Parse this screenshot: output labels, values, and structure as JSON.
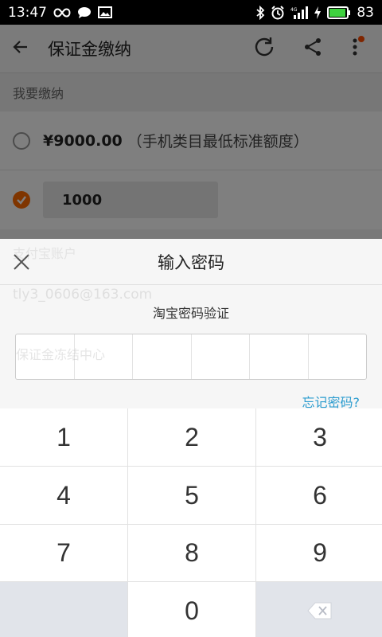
{
  "status": {
    "time": "13:47",
    "battery": "83"
  },
  "appbar": {
    "title": "保证金缴纳"
  },
  "section": {
    "label": "我要缴纳"
  },
  "options": [
    {
      "amount": "¥9000.00",
      "note": "（手机类目最低标准额度）",
      "checked": false
    },
    {
      "input_value": "1000",
      "checked": true
    }
  ],
  "background": {
    "account_label": "支付宝账户",
    "account": "tly3_0606@163.com",
    "pin_placeholder": "保证金冻结中心"
  },
  "sheet": {
    "title": "输入密码",
    "subtitle": "淘宝密码验证",
    "forgot": "忘记密码?"
  },
  "keypad": {
    "keys": [
      "1",
      "2",
      "3",
      "4",
      "5",
      "6",
      "7",
      "8",
      "9",
      "0"
    ]
  }
}
